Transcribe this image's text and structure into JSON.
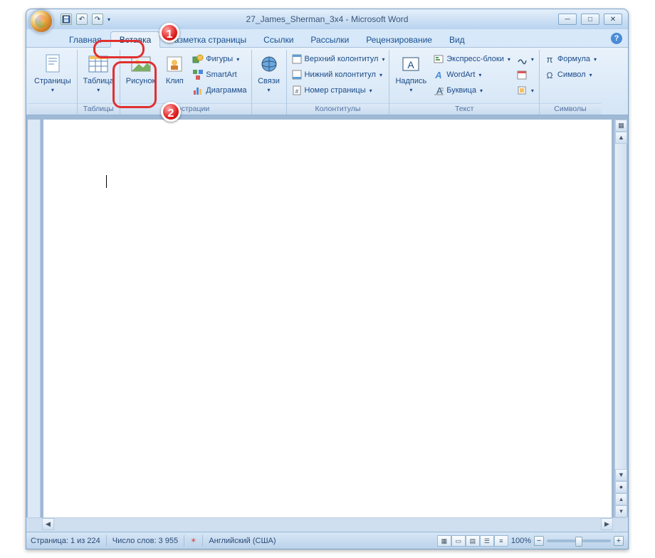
{
  "title": "27_James_Sherman_3x4 - Microsoft Word",
  "tabs": {
    "home": "Главная",
    "insert": "Вставка",
    "page_layout": "Разметка страницы",
    "references": "Ссылки",
    "mailings": "Рассылки",
    "review": "Рецензирование",
    "view": "Вид"
  },
  "ribbon": {
    "pages": {
      "button": "Страницы",
      "group": ""
    },
    "tables": {
      "button": "Таблица",
      "group": "Таблицы"
    },
    "illustrations": {
      "picture": "Рисунок",
      "clip": "Клип",
      "shapes": "Фигуры",
      "smartart": "SmartArt",
      "chart": "Диаграмма",
      "group": "Иллюстрации"
    },
    "links": {
      "button": "Связи",
      "group": ""
    },
    "headerfooter": {
      "header": "Верхний колонтитул",
      "footer": "Нижний колонтитул",
      "pagenum": "Номер страницы",
      "group": "Колонтитулы"
    },
    "text": {
      "textbox": "Надпись",
      "quickparts": "Экспресс-блоки",
      "wordart": "WordArt",
      "dropcap": "Буквица",
      "group": "Текст"
    },
    "symbols": {
      "equation": "Формула",
      "symbol": "Символ",
      "group": "Символы"
    }
  },
  "status": {
    "page": "Страница: 1 из 224",
    "words": "Число слов: 3 955",
    "lang": "Английский (США)",
    "zoom": "100%"
  },
  "callouts": {
    "one": "1",
    "two": "2"
  }
}
